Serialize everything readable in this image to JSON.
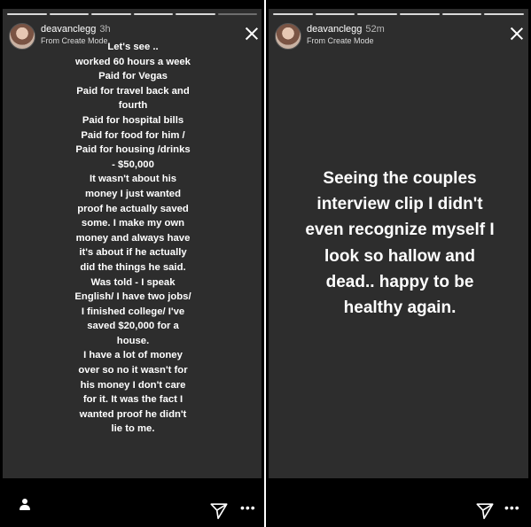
{
  "left_story": {
    "username": "deavanclegg",
    "timestamp": "3h",
    "subtitle": "From Create Mode",
    "text_lines": [
      "Let's see ..",
      "worked 60 hours a week",
      "Paid for Vegas",
      "Paid for travel back and",
      "fourth",
      "Paid for hospital bills",
      "Paid for food for him /",
      "Paid for housing /drinks",
      "- $50,000",
      "It wasn't about his",
      "money I just wanted",
      "proof he actually saved",
      "some. I make my own",
      "money and always have",
      "it's about if he actually",
      "did the things he said.",
      "Was told - I speak",
      "English/ I have two jobs/",
      "I finished college/ I've",
      "saved $20,000 for a",
      "house.",
      "I have a lot of money",
      "over so no it wasn't for",
      "his money I don't care",
      "for it. It was the fact I",
      "wanted proof he didn't",
      "lie to me."
    ],
    "progress_total": 6,
    "progress_done": 5,
    "icons": {
      "close": "close-icon",
      "profile": "person-icon",
      "send": "send-icon",
      "more": "more-options-icon"
    },
    "more_glyph": "•••"
  },
  "right_story": {
    "username": "deavanclegg",
    "timestamp": "52m",
    "subtitle": "From Create Mode",
    "text_lines": [
      "Seeing the couples",
      "interview clip I didn't",
      "even recognize myself I",
      "look so hallow and",
      "dead.. happy to be",
      "healthy again."
    ],
    "progress_total": 6,
    "progress_done": 6,
    "icons": {
      "close": "close-icon",
      "send": "send-icon",
      "more": "more-options-icon"
    },
    "more_glyph": "•••"
  },
  "colors": {
    "story_background": "#2d2d2d",
    "frame": "#000000",
    "text": "#ffffff",
    "progress_done": "#d9d9d9",
    "progress_pending": "#6e6e6e"
  }
}
